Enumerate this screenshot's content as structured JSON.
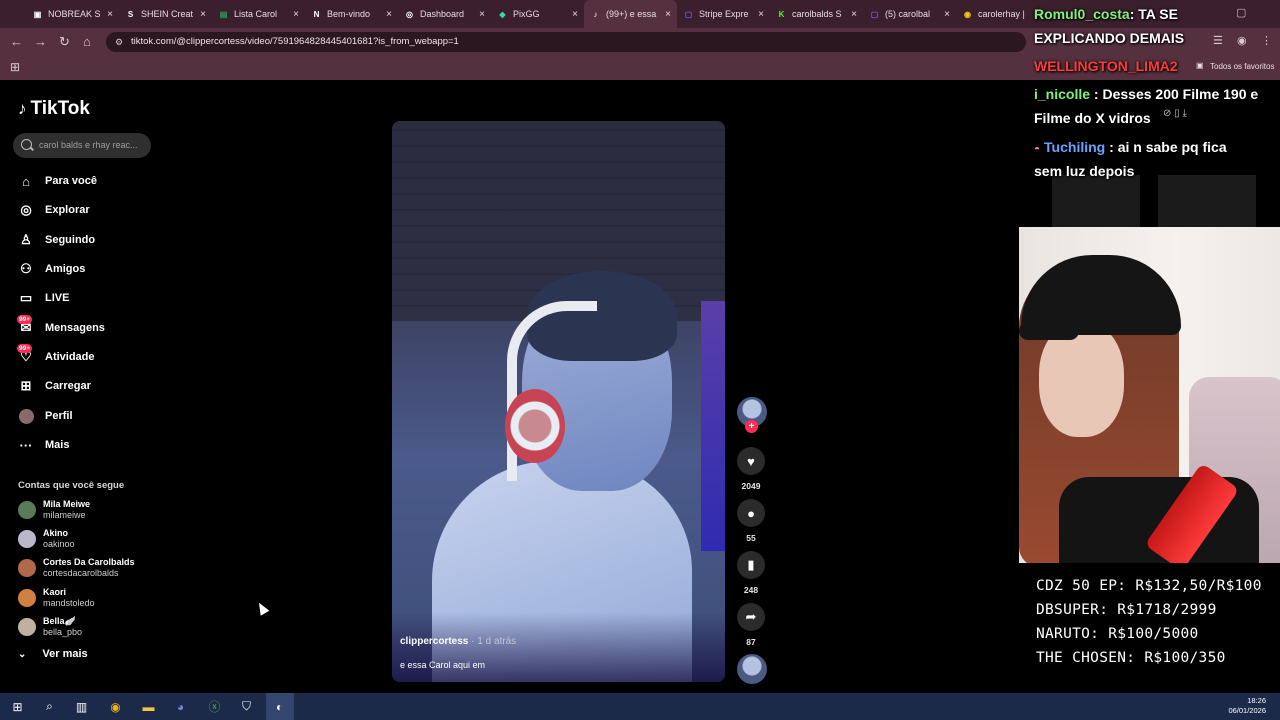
{
  "browser": {
    "tabs": [
      {
        "label": "NOBREAK S",
        "fav_color": "#ffffff",
        "fav_glyph": "▣",
        "active": false
      },
      {
        "label": "SHEIN Creat",
        "fav_color": "#ffffff",
        "fav_glyph": "S",
        "active": false
      },
      {
        "label": "Lista Carol",
        "fav_color": "#1fa463",
        "fav_glyph": "▤",
        "active": false
      },
      {
        "label": "Bem-vindo",
        "fav_color": "#ffffff",
        "fav_glyph": "N",
        "active": false
      },
      {
        "label": "Dashboard",
        "fav_color": "#ffffff",
        "fav_glyph": "◎",
        "active": false
      },
      {
        "label": "PixGG",
        "fav_color": "#3ad6a0",
        "fav_glyph": "◆",
        "active": false
      },
      {
        "label": "(99+) e essa",
        "fav_color": "#ffffff",
        "fav_glyph": "♪",
        "active": true
      },
      {
        "label": "Stripe Expre",
        "fav_color": "#635bff",
        "fav_glyph": "▢",
        "active": false
      },
      {
        "label": "carolbalds S",
        "fav_color": "#53fc18",
        "fav_glyph": "K",
        "active": false
      },
      {
        "label": "(5) carolbal",
        "fav_color": "#9146ff",
        "fav_glyph": "▢",
        "active": false
      },
      {
        "label": "carolerhay |",
        "fav_color": "#f2c811",
        "fav_glyph": "◉",
        "active": false
      }
    ],
    "close_glyph": "×",
    "url": "tiktok.com/@clippercortess/video/7591964828445401681?is_from_webapp=1",
    "bookmarks_label": "Todos os favoritos"
  },
  "tiktok": {
    "brand": "TikTok",
    "search_placeholder": "carol balds e rhay reac...",
    "nav": [
      {
        "label": "Para você",
        "icon": "home-icon",
        "glyph": "⌂",
        "badge": ""
      },
      {
        "label": "Explorar",
        "icon": "compass-icon",
        "glyph": "◎",
        "badge": ""
      },
      {
        "label": "Seguindo",
        "icon": "following-icon",
        "glyph": "♙",
        "badge": ""
      },
      {
        "label": "Amigos",
        "icon": "friends-icon",
        "glyph": "⚇",
        "badge": ""
      },
      {
        "label": "LIVE",
        "icon": "live-icon",
        "glyph": "▭",
        "badge": ""
      },
      {
        "label": "Mensagens",
        "icon": "messages-icon",
        "glyph": "✉",
        "badge": "99+"
      },
      {
        "label": "Atividade",
        "icon": "activity-icon",
        "glyph": "♡",
        "badge": "99+"
      },
      {
        "label": "Carregar",
        "icon": "upload-icon",
        "glyph": "⊞",
        "badge": ""
      },
      {
        "label": "Perfil",
        "icon": "profile-avatar-icon",
        "glyph": "●",
        "badge": ""
      },
      {
        "label": "Mais",
        "icon": "more-icon",
        "glyph": "···",
        "badge": ""
      }
    ],
    "following_title": "Contas que você segue",
    "following": [
      {
        "name": "Mila Meiwe",
        "user": "milameiwe",
        "color": "#5a7a5a"
      },
      {
        "name": "Akino",
        "user": "oakinoo",
        "color": "#b9b9c9"
      },
      {
        "name": "Cortes Da Carolbalds",
        "user": "cortesdacarolbalds",
        "color": "#b06a4a"
      },
      {
        "name": "Kaori",
        "user": "mandstoledo",
        "color": "#d08040"
      },
      {
        "name": "Bella🪽",
        "user": "bella_pbo",
        "color": "#c0b0a0"
      }
    ],
    "see_more": "Ver mais",
    "video": {
      "author": "clippercortess",
      "time": " · 1 d atrás",
      "caption": "e essa Carol aqui em"
    },
    "actions": {
      "likes": "2049",
      "comments": "55",
      "saves": "248",
      "shares": "87"
    }
  },
  "overlay": {
    "chat": [
      {
        "user": "Romul0_costa",
        "sep": ": ",
        "text": "TA SE",
        "color": "green"
      },
      {
        "user": "",
        "sep": "",
        "text": "EXPLICANDO DEMAIS",
        "color": ""
      },
      {
        "user": "WELLINGTON_LIMA2",
        "sep": "",
        "text": "",
        "color": "red"
      },
      {
        "user": "i_nicolle",
        "sep": " : ",
        "text": "Desses 200 Filme 190 e",
        "color": "green"
      },
      {
        "user": "",
        "sep": "",
        "text": "Filme do X vidros",
        "color": ""
      },
      {
        "user": "Tuchiling",
        "sep": " : ",
        "text": "ai n sabe pq fica",
        "color": "blue"
      },
      {
        "user": "",
        "sep": "",
        "text": "sem luz depois",
        "color": ""
      }
    ],
    "goals": [
      "CDZ 50 EP: R$132,50/R$100",
      "DBSUPER: R$1718/2999",
      "NARUTO: R$100/5000",
      "THE CHOSEN: R$100/350"
    ]
  },
  "taskbar": {
    "time": "18:26",
    "date": "06/01/2026"
  }
}
